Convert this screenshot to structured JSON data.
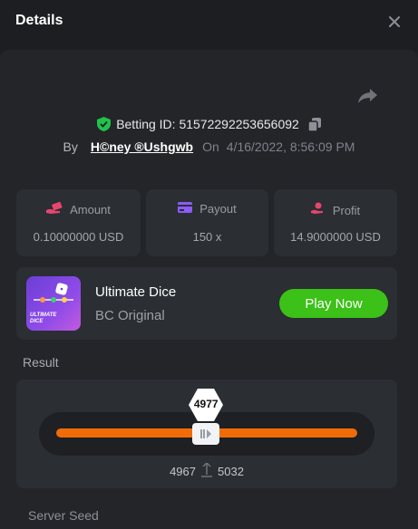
{
  "header": {
    "title": "Details"
  },
  "bet": {
    "id_text": "Betting ID: 51572292253656092",
    "by_label": "By",
    "username": "H©ney ®Ushgwb",
    "on_label": "On",
    "date": "4/16/2022, 8:56:09 PM"
  },
  "stats": [
    {
      "label": "Amount",
      "value": "0.10000000 USD",
      "icon": "money-hand-icon",
      "color": "#e8456d"
    },
    {
      "label": "Payout",
      "value": "150 x",
      "icon": "card-icon",
      "color": "#8b5cf6"
    },
    {
      "label": "Profit",
      "value": "14.9000000 USD",
      "icon": "profit-hand-icon",
      "color": "#e8456d"
    }
  ],
  "game": {
    "name": "Ultimate Dice",
    "provider": "BC Original",
    "thumb_text": "ULTIMATE DICE",
    "play_label": "Play Now",
    "play_color": "#3bc117"
  },
  "result": {
    "label": "Result",
    "value": "4977",
    "range_low": "4967",
    "range_high": "5032",
    "position_fraction": 0.4977,
    "bar_color": "#f06c08"
  },
  "server_seed_label": "Server Seed",
  "colors": {
    "accent_green": "#21c24a",
    "panel": "#2b2e33",
    "background": "#1c1e22"
  }
}
